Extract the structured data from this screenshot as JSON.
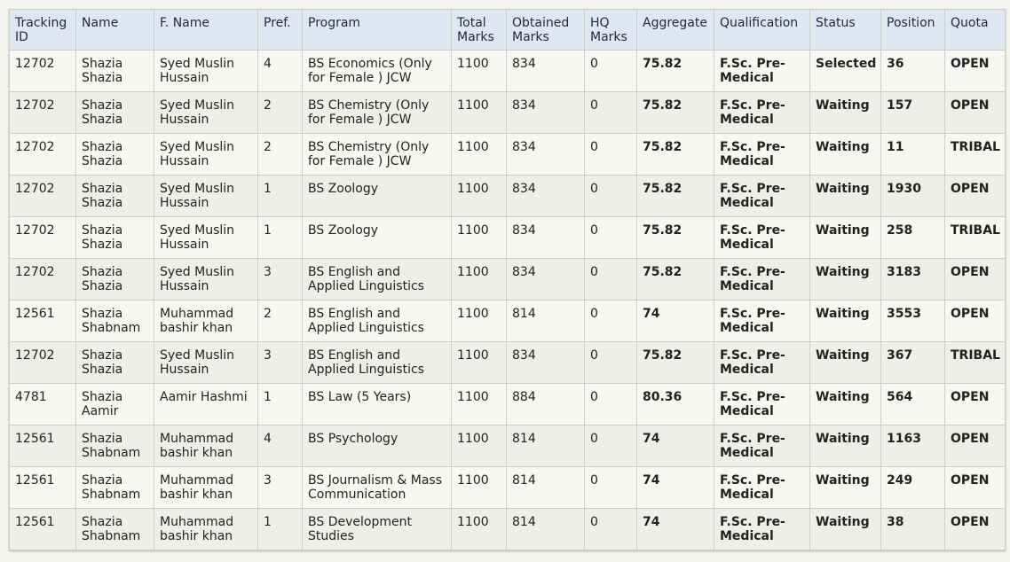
{
  "table": {
    "headers": [
      {
        "key": "tracking_id",
        "label": "Tracking ID"
      },
      {
        "key": "name",
        "label": "Name"
      },
      {
        "key": "father_name",
        "label": "F. Name"
      },
      {
        "key": "pref",
        "label": "Pref."
      },
      {
        "key": "program",
        "label": "Program"
      },
      {
        "key": "total_marks",
        "label": "Total Marks"
      },
      {
        "key": "obtained_marks",
        "label": "Obtained Marks"
      },
      {
        "key": "hq_marks",
        "label": "HQ Marks"
      },
      {
        "key": "aggregate",
        "label": "Aggregate"
      },
      {
        "key": "qualification",
        "label": "Qualification"
      },
      {
        "key": "status",
        "label": "Status"
      },
      {
        "key": "position",
        "label": "Position"
      },
      {
        "key": "quota",
        "label": "Quota"
      }
    ],
    "rows": [
      {
        "tracking_id": "12702",
        "name": "Shazia Shazia",
        "father_name": "Syed Muslin Hussain",
        "pref": "4",
        "program": "BS Economics (Only for Female ) JCW",
        "total_marks": "1100",
        "obtained_marks": "834",
        "hq_marks": "0",
        "aggregate": "75.82",
        "qualification": "F.Sc. Pre-Medical",
        "status": "Selected",
        "position": "36",
        "quota": "OPEN"
      },
      {
        "tracking_id": "12702",
        "name": "Shazia Shazia",
        "father_name": "Syed Muslin Hussain",
        "pref": "2",
        "program": "BS Chemistry (Only for Female ) JCW",
        "total_marks": "1100",
        "obtained_marks": "834",
        "hq_marks": "0",
        "aggregate": "75.82",
        "qualification": "F.Sc. Pre-Medical",
        "status": "Waiting",
        "position": "157",
        "quota": "OPEN"
      },
      {
        "tracking_id": "12702",
        "name": "Shazia Shazia",
        "father_name": "Syed Muslin Hussain",
        "pref": "2",
        "program": "BS Chemistry (Only for Female ) JCW",
        "total_marks": "1100",
        "obtained_marks": "834",
        "hq_marks": "0",
        "aggregate": "75.82",
        "qualification": "F.Sc. Pre-Medical",
        "status": "Waiting",
        "position": "11",
        "quota": "TRIBAL"
      },
      {
        "tracking_id": "12702",
        "name": "Shazia Shazia",
        "father_name": "Syed Muslin Hussain",
        "pref": "1",
        "program": "BS Zoology",
        "total_marks": "1100",
        "obtained_marks": "834",
        "hq_marks": "0",
        "aggregate": "75.82",
        "qualification": "F.Sc. Pre-Medical",
        "status": "Waiting",
        "position": "1930",
        "quota": "OPEN"
      },
      {
        "tracking_id": "12702",
        "name": "Shazia Shazia",
        "father_name": "Syed Muslin Hussain",
        "pref": "1",
        "program": "BS Zoology",
        "total_marks": "1100",
        "obtained_marks": "834",
        "hq_marks": "0",
        "aggregate": "75.82",
        "qualification": "F.Sc. Pre-Medical",
        "status": "Waiting",
        "position": "258",
        "quota": "TRIBAL"
      },
      {
        "tracking_id": "12702",
        "name": "Shazia Shazia",
        "father_name": "Syed Muslin Hussain",
        "pref": "3",
        "program": "BS English and Applied Linguistics",
        "total_marks": "1100",
        "obtained_marks": "834",
        "hq_marks": "0",
        "aggregate": "75.82",
        "qualification": "F.Sc. Pre-Medical",
        "status": "Waiting",
        "position": "3183",
        "quota": "OPEN"
      },
      {
        "tracking_id": "12561",
        "name": "Shazia Shabnam",
        "father_name": "Muhammad bashir khan",
        "pref": "2",
        "program": "BS English and Applied Linguistics",
        "total_marks": "1100",
        "obtained_marks": "814",
        "hq_marks": "0",
        "aggregate": "74",
        "qualification": "F.Sc. Pre-Medical",
        "status": "Waiting",
        "position": "3553",
        "quota": "OPEN"
      },
      {
        "tracking_id": "12702",
        "name": "Shazia Shazia",
        "father_name": "Syed Muslin Hussain",
        "pref": "3",
        "program": "BS English and Applied Linguistics",
        "total_marks": "1100",
        "obtained_marks": "834",
        "hq_marks": "0",
        "aggregate": "75.82",
        "qualification": "F.Sc. Pre-Medical",
        "status": "Waiting",
        "position": "367",
        "quota": "TRIBAL"
      },
      {
        "tracking_id": "4781",
        "name": "Shazia Aamir",
        "father_name": "Aamir Hashmi",
        "pref": "1",
        "program": "BS Law (5 Years)",
        "total_marks": "1100",
        "obtained_marks": "884",
        "hq_marks": "0",
        "aggregate": "80.36",
        "qualification": "F.Sc. Pre-Medical",
        "status": "Waiting",
        "position": "564",
        "quota": "OPEN"
      },
      {
        "tracking_id": "12561",
        "name": "Shazia Shabnam",
        "father_name": "Muhammad bashir khan",
        "pref": "4",
        "program": "BS Psychology",
        "total_marks": "1100",
        "obtained_marks": "814",
        "hq_marks": "0",
        "aggregate": "74",
        "qualification": "F.Sc. Pre-Medical",
        "status": "Waiting",
        "position": "1163",
        "quota": "OPEN"
      },
      {
        "tracking_id": "12561",
        "name": "Shazia Shabnam",
        "father_name": "Muhammad bashir khan",
        "pref": "3",
        "program": "BS Journalism & Mass Communication",
        "total_marks": "1100",
        "obtained_marks": "814",
        "hq_marks": "0",
        "aggregate": "74",
        "qualification": "F.Sc. Pre-Medical",
        "status": "Waiting",
        "position": "249",
        "quota": "OPEN"
      },
      {
        "tracking_id": "12561",
        "name": "Shazia Shabnam",
        "father_name": "Muhammad bashir khan",
        "pref": "1",
        "program": "BS Development Studies",
        "total_marks": "1100",
        "obtained_marks": "814",
        "hq_marks": "0",
        "aggregate": "74",
        "qualification": "F.Sc. Pre-Medical",
        "status": "Waiting",
        "position": "38",
        "quota": "OPEN"
      }
    ]
  }
}
